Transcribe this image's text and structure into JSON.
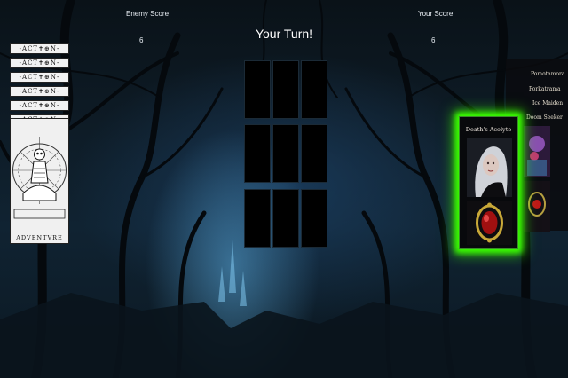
{
  "scores": {
    "enemy_label": "Enemy Score",
    "enemy_value": "6",
    "player_label": "Your Score",
    "player_value": "6"
  },
  "turn_text": "Your Turn!",
  "enemy_deck": {
    "cards": [
      "-ACT✝⊕N-",
      "-ACT✝⊕N-",
      "-ACT✝⊕N-",
      "-ACT✝⊕N-",
      "-ACT✝⊕N-",
      "-ACT✝⊕N-"
    ],
    "main_caption": "ADVENTVRE"
  },
  "board": {
    "rows": 3,
    "cols": 3
  },
  "player_hand": {
    "cards": [
      "Pomotamora",
      "Porkatrama",
      "Ice Maiden",
      "Doom Seeker"
    ]
  },
  "active_card": {
    "name": "Death's Acolyte",
    "highlight_color": "#3aff00"
  },
  "icons": [
    "skeleton-icon",
    "portrait-icon",
    "gem-icon"
  ]
}
